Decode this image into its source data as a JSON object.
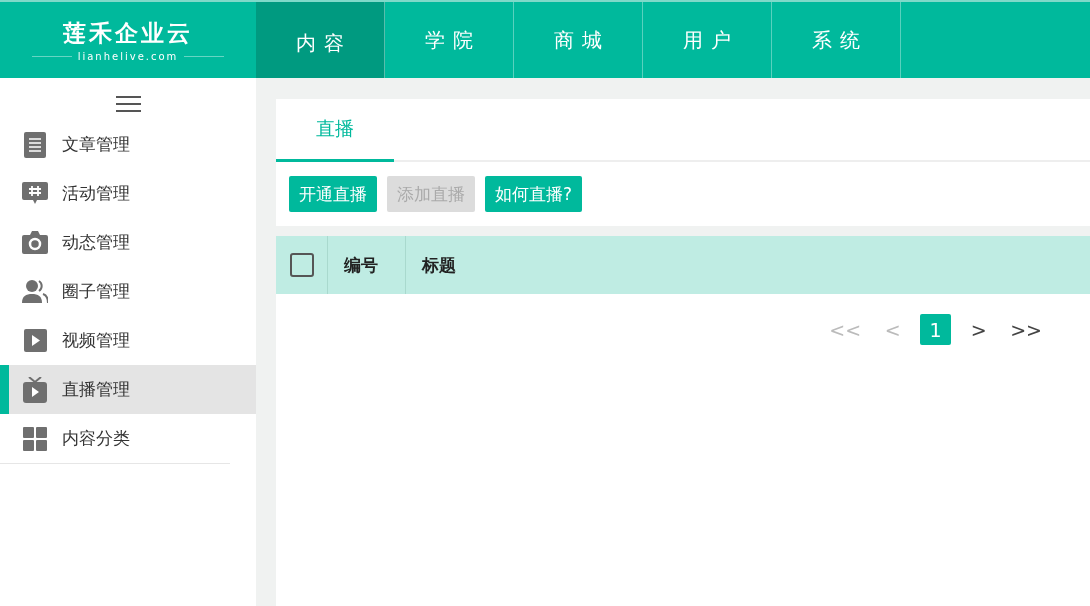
{
  "logo": {
    "name": "莲禾企业云",
    "domain": "lianhelive.com"
  },
  "nav": [
    {
      "label": "内容",
      "selected": true
    },
    {
      "label": "学院",
      "selected": false
    },
    {
      "label": "商城",
      "selected": false
    },
    {
      "label": "用户",
      "selected": false
    },
    {
      "label": "系统",
      "selected": false
    }
  ],
  "sidebar": {
    "items": [
      {
        "label": "文章管理",
        "selected": false
      },
      {
        "label": "活动管理",
        "selected": false
      },
      {
        "label": "动态管理",
        "selected": false
      },
      {
        "label": "圈子管理",
        "selected": false
      },
      {
        "label": "视频管理",
        "selected": false
      },
      {
        "label": "直播管理",
        "selected": true
      },
      {
        "label": "内容分类",
        "selected": false
      }
    ]
  },
  "content_tabs": [
    {
      "label": "直播",
      "selected": true
    }
  ],
  "buttons": [
    {
      "label": "开通直播",
      "disabled": false
    },
    {
      "label": "添加直播",
      "disabled": true
    },
    {
      "label": "如何直播?",
      "disabled": false
    }
  ],
  "table": {
    "select_all": {
      "checked": false
    },
    "columns": [
      "编号",
      "标题"
    ]
  },
  "pagination": [
    {
      "label": "<<",
      "disabled": true,
      "selected": false
    },
    {
      "label": "<",
      "disabled": true,
      "selected": false
    },
    {
      "label": "1",
      "disabled": false,
      "selected": true
    },
    {
      "label": ">",
      "disabled": false,
      "selected": false
    },
    {
      "label": ">>",
      "disabled": false,
      "selected": false
    }
  ]
}
